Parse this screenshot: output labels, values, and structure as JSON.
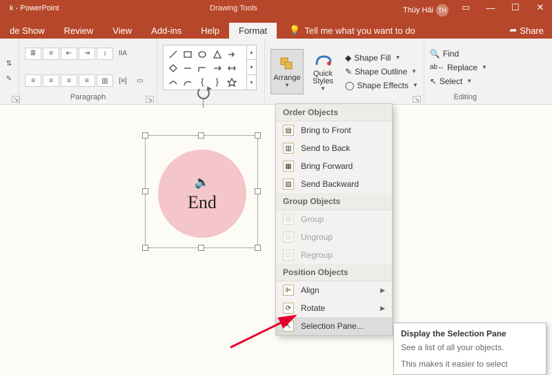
{
  "titlebar": {
    "app": "k - PowerPoint",
    "tool": "Drawing Tools",
    "user": "Thúy Hải",
    "initials": "TH"
  },
  "tabs": {
    "items": [
      "de Show",
      "Review",
      "View",
      "Add-ins",
      "Help",
      "Format"
    ],
    "tell": "Tell me what you want to do",
    "share": "Share"
  },
  "ribbon": {
    "paragraph": {
      "label": "Paragraph"
    },
    "arrange": "Arrange",
    "quick_styles": "Quick\nStyles",
    "shape_fill": "Shape Fill",
    "shape_outline": "Shape Outline",
    "shape_effects": "Shape Effects",
    "find": "Find",
    "replace": "Replace",
    "select": "Select",
    "editing": "Editing"
  },
  "shape_text": "End",
  "menu": {
    "s1": "Order Objects",
    "bring_front": "Bring to Front",
    "send_back": "Send to Back",
    "bring_forward": "Bring Forward",
    "send_backward": "Send Backward",
    "s2": "Group Objects",
    "group": "Group",
    "ungroup": "Ungroup",
    "regroup": "Regroup",
    "s3": "Position Objects",
    "align": "Align",
    "rotate": "Rotate",
    "selection_pane": "Selection Pane..."
  },
  "tooltip": {
    "title": "Display the Selection Pane",
    "body1": "See a list of all your objects.",
    "body2": "This makes it easier to select"
  }
}
